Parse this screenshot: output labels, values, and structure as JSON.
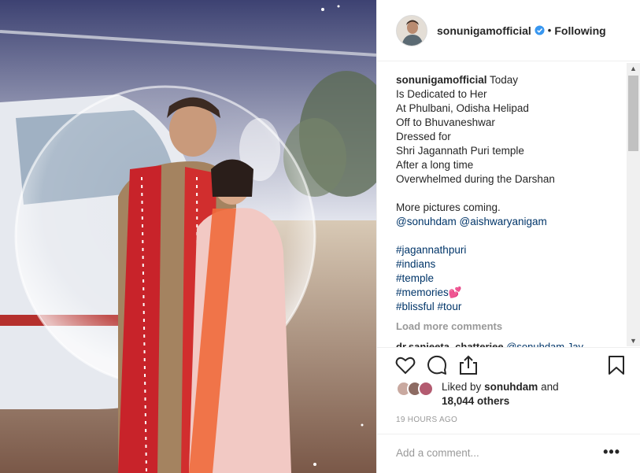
{
  "header": {
    "username": "sonunigamofficial",
    "separator": "•",
    "follow_state": "Following"
  },
  "caption": {
    "username": "sonunigamofficial",
    "lines": [
      "Today",
      "Is Dedicated to Her",
      "At Phulbani, Odisha Helipad",
      "Off to Bhuvaneshwar",
      "Dressed for",
      "Shri Jagannath Puri temple",
      "After a long time",
      "Overwhelmed during the Darshan"
    ],
    "more_pictures": "More pictures coming.",
    "mentions": [
      "@sonuhdam",
      "@aishwaryanigam"
    ],
    "hashtags": [
      "#jagannathpuri",
      "#indians",
      "#temple",
      "#memories"
    ],
    "memories_emoji": "💕",
    "hashtags_last": [
      "#blissful",
      "#tour"
    ]
  },
  "load_more": "Load more comments",
  "next_comment": {
    "username": "dr.sanjeeta_chatterjee",
    "text": "@sonuhdam Jay"
  },
  "actions": {
    "like": "heart-icon",
    "comment": "comment-icon",
    "share": "share-icon",
    "save": "bookmark-icon"
  },
  "likes": {
    "prefix": "Liked by",
    "user": "sonuhdam",
    "and": "and",
    "count": "18,044 others"
  },
  "timestamp": "19 HOURS AGO",
  "add_comment_placeholder": "Add a comment...",
  "more_options": "•••",
  "colors": {
    "link": "#003569",
    "verified": "#3897f0",
    "muted": "#999999",
    "text": "#262626"
  }
}
